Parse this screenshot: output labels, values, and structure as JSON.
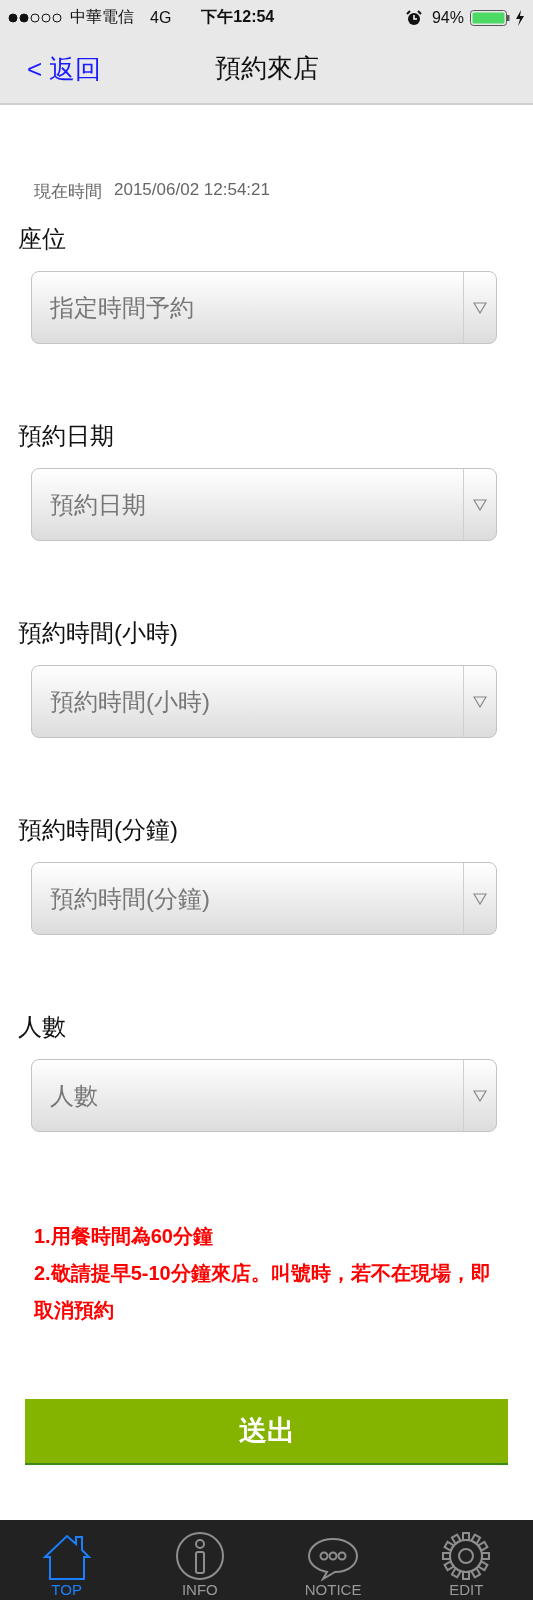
{
  "status_bar": {
    "carrier": "中華電信",
    "network": "4G",
    "time": "下午12:54",
    "battery": "94%"
  },
  "nav_bar": {
    "back": "< 返回",
    "title": "預約來店"
  },
  "current_time": {
    "label": "現在時間",
    "value": "2015/06/02 12:54:21"
  },
  "fields": [
    {
      "label": "座位",
      "value": "指定時間予約"
    },
    {
      "label": "預約日期",
      "value": "預約日期"
    },
    {
      "label": "預約時間(小時)",
      "value": "預約時間(小時)"
    },
    {
      "label": "預約時間(分鐘)",
      "value": "預約時間(分鐘)"
    },
    {
      "label": "人數",
      "value": "人數"
    }
  ],
  "notes": [
    "1.用餐時間為60分鐘",
    "2.敬請提早5-10分鐘來店。叫號時，若不在現場，即取消預約"
  ],
  "submit": "送出",
  "tab_bar": [
    {
      "label": "TOP",
      "selected": true
    },
    {
      "label": "INFO",
      "selected": false
    },
    {
      "label": "NOTICE",
      "selected": false
    },
    {
      "label": "EDIT",
      "selected": false
    }
  ]
}
